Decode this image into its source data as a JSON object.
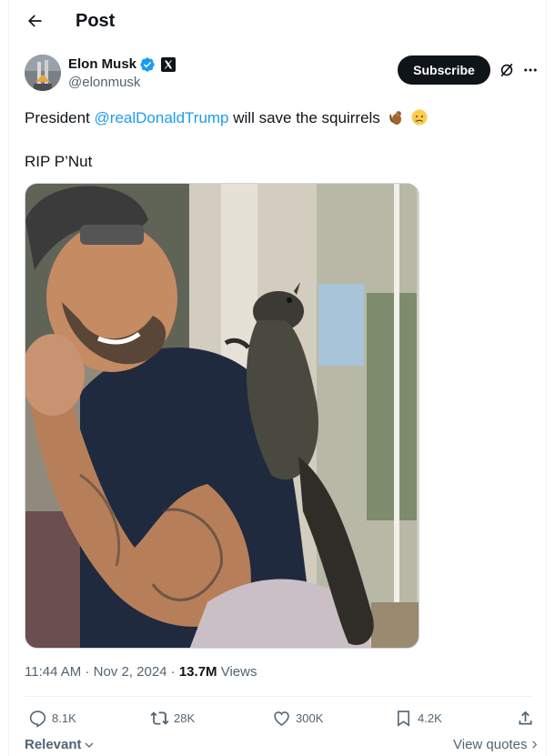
{
  "header": {
    "title": "Post"
  },
  "author": {
    "name": "Elon Musk",
    "handle": "@elonmusk"
  },
  "buttons": {
    "subscribe": "Subscribe"
  },
  "tweet": {
    "text_before": "President ",
    "mention": "@realDonaldTrump",
    "text_after": " will save the squirrels",
    "emojis": [
      "chipmunk-emoji",
      "crying-face-emoji"
    ],
    "line2": "RIP P’Nut"
  },
  "meta": {
    "time": "11:44 AM",
    "sep1": " · ",
    "date": "Nov 2, 2024",
    "sep2": " · ",
    "views_count": "13.7M",
    "views_label": " Views"
  },
  "actions": {
    "replies": "8.1K",
    "reposts": "28K",
    "likes": "300K",
    "bookmarks": "4.2K"
  },
  "footer": {
    "sort": "Relevant",
    "view_quotes": "View quotes"
  },
  "colors": {
    "accent": "#1d9bf0",
    "text": "#0f1419",
    "secondary": "#536471"
  }
}
